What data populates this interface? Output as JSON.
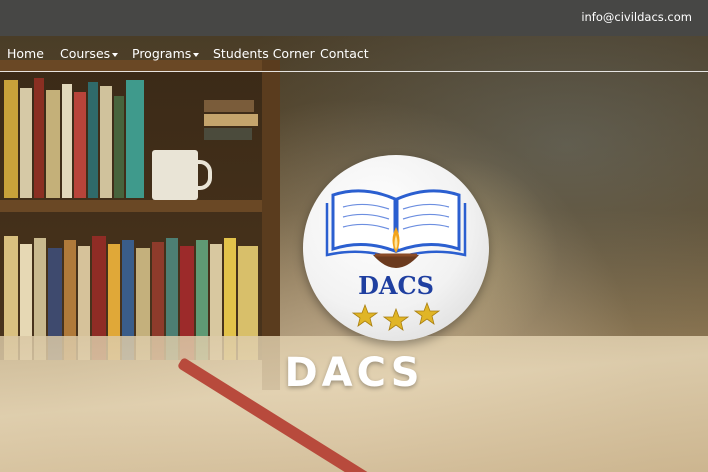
{
  "topbar": {
    "email": "info@civildacs.com"
  },
  "nav": {
    "items": [
      {
        "label": "Home",
        "has_dropdown": false
      },
      {
        "label": "Courses",
        "has_dropdown": true
      },
      {
        "label": "Programs",
        "has_dropdown": true
      },
      {
        "label": "Students Corner",
        "has_dropdown": false
      },
      {
        "label": "Contact",
        "has_dropdown": false
      }
    ]
  },
  "logo": {
    "text": "DACS",
    "star_count": 3
  },
  "hero": {
    "title": "DACS"
  },
  "colors": {
    "topbar": "#474745",
    "logo_text": "#1f3fa0",
    "star": "#e0b526",
    "book_blue": "#2b5fd0"
  },
  "icons": [
    "book-icon",
    "lamp-icon",
    "star-icon",
    "chevron-down-icon"
  ]
}
